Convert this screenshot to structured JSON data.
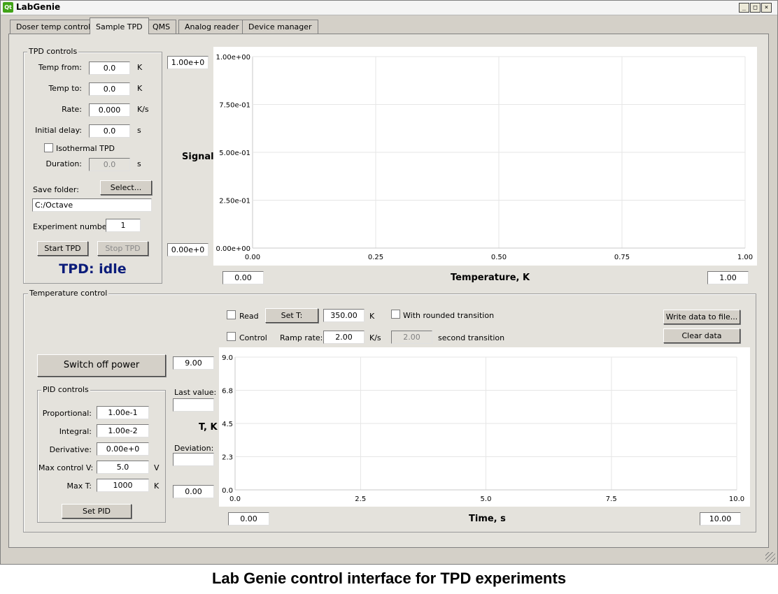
{
  "window": {
    "title": "LabGenie",
    "logo": "Qt"
  },
  "tabs": [
    "Doser temp control",
    "Sample TPD",
    "QMS",
    "Analog reader",
    "Device manager"
  ],
  "active_tab": 1,
  "tpd": {
    "group_title": "TPD controls",
    "temp_from_label": "Temp from:",
    "temp_from": "0.0",
    "temp_from_unit": "K",
    "temp_to_label": "Temp to:",
    "temp_to": "0.0",
    "temp_to_unit": "K",
    "rate_label": "Rate:",
    "rate": "0.000",
    "rate_unit": "K/s",
    "delay_label": "Initial delay:",
    "delay": "0.0",
    "delay_unit": "s",
    "isothermal_label": "Isothermal TPD",
    "duration_label": "Duration:",
    "duration": "0.0",
    "duration_unit": "s",
    "save_folder_label": "Save folder:",
    "select_button": "Select...",
    "save_folder": "C:/Octave",
    "experiment_label": "Experiment number:",
    "experiment_number": "1",
    "start_button": "Start TPD",
    "stop_button": "Stop TPD",
    "status": "TPD: idle"
  },
  "signal_plot": {
    "ymax_field": "1.00e+0",
    "ymin_field": "0.00e+0",
    "xmin_field": "0.00",
    "xmax_field": "1.00"
  },
  "temp_control": {
    "group_title": "Temperature control",
    "read_label": "Read",
    "set_t_button": "Set T:",
    "set_t": "350.00",
    "set_t_unit": "K",
    "rounded_label": "With rounded transition",
    "control_label": "Control",
    "ramp_label": "Ramp rate:",
    "ramp": "2.00",
    "ramp_unit": "K/s",
    "second_transition": "2.00",
    "second_transition_label": "second transition",
    "write_button": "Write data to file...",
    "clear_button": "Clear data",
    "power_button": "Switch off power",
    "ymax_field": "9.00",
    "ymin_field": "0.00",
    "last_value_label": "Last value:",
    "last_value": "",
    "deviation_label": "Deviation:",
    "deviation": "",
    "xmin_field": "0.00",
    "xmax_field": "10.00"
  },
  "pid": {
    "group_title": "PID controls",
    "proportional_label": "Proportional:",
    "proportional": "1.00e-1",
    "integral_label": "Integral:",
    "integral": "1.00e-2",
    "derivative_label": "Derivative:",
    "derivative": "0.00e+0",
    "max_v_label": "Max control V:",
    "max_v": "5.0",
    "max_v_unit": "V",
    "max_t_label": "Max T:",
    "max_t": "1000",
    "max_t_unit": "K",
    "set_button": "Set PID"
  },
  "caption": "Lab Genie control interface for TPD experiments",
  "chart_data": [
    {
      "type": "line",
      "title": "",
      "xlabel": "Temperature, K",
      "ylabel": "Signal",
      "xlim": [
        0,
        1
      ],
      "ylim": [
        0,
        1
      ],
      "x_ticks": [
        "0.00",
        "0.25",
        "0.50",
        "0.75",
        "1.00"
      ],
      "y_ticks": [
        "0.00e+00",
        "2.50e-01",
        "5.00e-01",
        "7.50e-01",
        "1.00e+00"
      ],
      "series": [],
      "grid": true
    },
    {
      "type": "line",
      "title": "",
      "xlabel": "Time, s",
      "ylabel": "T, K",
      "xlim": [
        0,
        10
      ],
      "ylim": [
        0,
        9
      ],
      "x_ticks": [
        "0.0",
        "2.5",
        "5.0",
        "7.5",
        "10.0"
      ],
      "y_ticks": [
        "0.0",
        "2.3",
        "4.5",
        "6.8",
        "9.0"
      ],
      "series": [],
      "grid": true
    }
  ]
}
